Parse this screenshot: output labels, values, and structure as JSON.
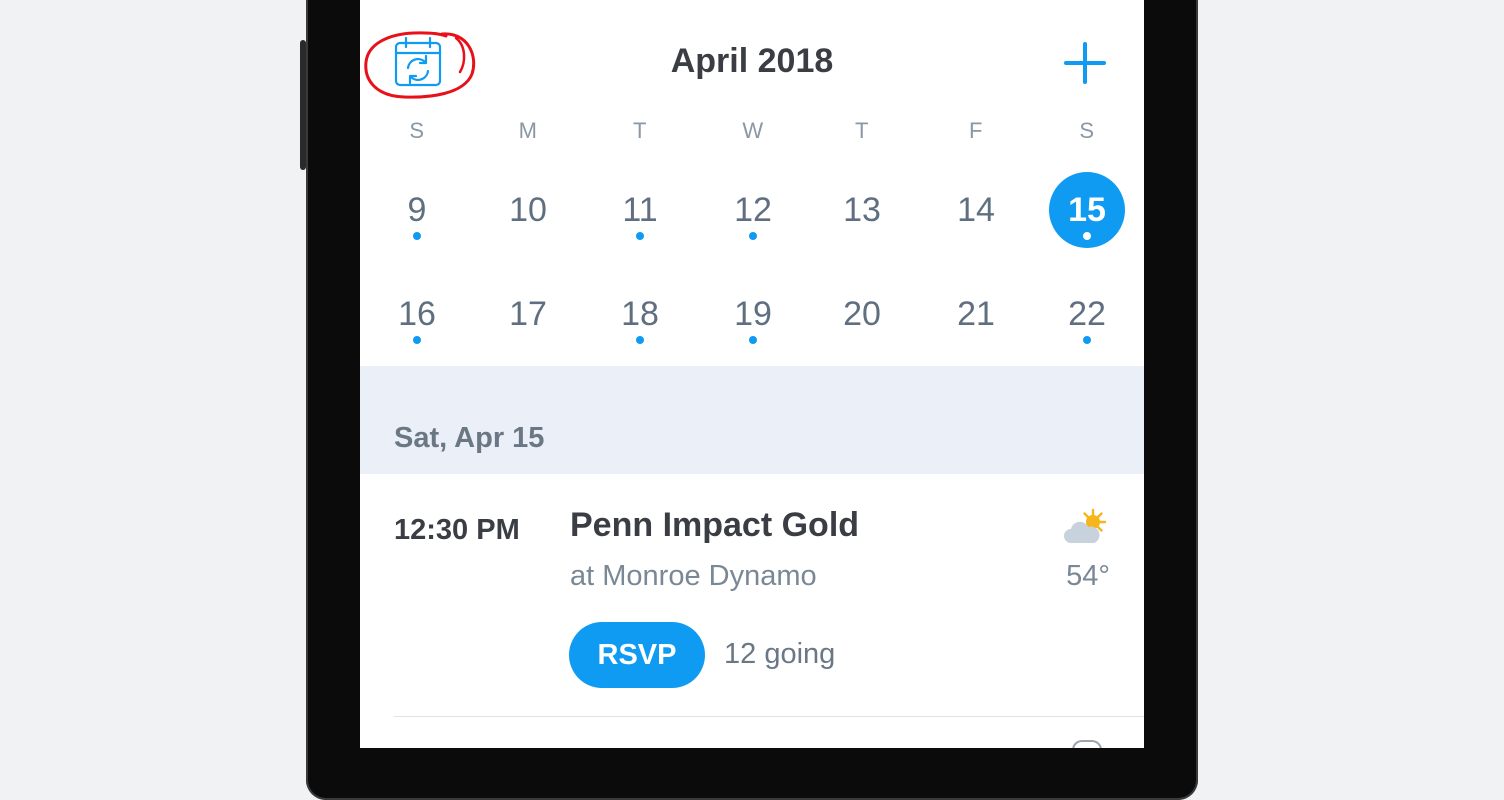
{
  "header": {
    "month_title": "April 2018",
    "sync_icon": "calendar-sync-icon",
    "add_icon": "plus-icon",
    "accent_color": "#0f9bf2",
    "annotation_color": "#e8101a"
  },
  "weekdays": [
    "S",
    "M",
    "T",
    "W",
    "T",
    "F",
    "S"
  ],
  "weeks": [
    [
      {
        "day": "9",
        "has_event": true,
        "selected": false
      },
      {
        "day": "10",
        "has_event": false,
        "selected": false
      },
      {
        "day": "11",
        "has_event": true,
        "selected": false
      },
      {
        "day": "12",
        "has_event": true,
        "selected": false
      },
      {
        "day": "13",
        "has_event": false,
        "selected": false
      },
      {
        "day": "14",
        "has_event": false,
        "selected": false
      },
      {
        "day": "15",
        "has_event": true,
        "selected": true
      }
    ],
    [
      {
        "day": "16",
        "has_event": true,
        "selected": false
      },
      {
        "day": "17",
        "has_event": false,
        "selected": false
      },
      {
        "day": "18",
        "has_event": true,
        "selected": false
      },
      {
        "day": "19",
        "has_event": true,
        "selected": false
      },
      {
        "day": "20",
        "has_event": false,
        "selected": false
      },
      {
        "day": "21",
        "has_event": false,
        "selected": false
      },
      {
        "day": "22",
        "has_event": true,
        "selected": false
      }
    ]
  ],
  "section": {
    "date_label": "Sat, Apr 15"
  },
  "event": {
    "time": "12:30 PM",
    "title": "Penn Impact Gold",
    "subtitle": "at Monroe Dynamo",
    "weather_icon": "partly-sunny-icon",
    "temperature": "54°",
    "rsvp_label": "RSVP",
    "going_label": "12 going"
  }
}
